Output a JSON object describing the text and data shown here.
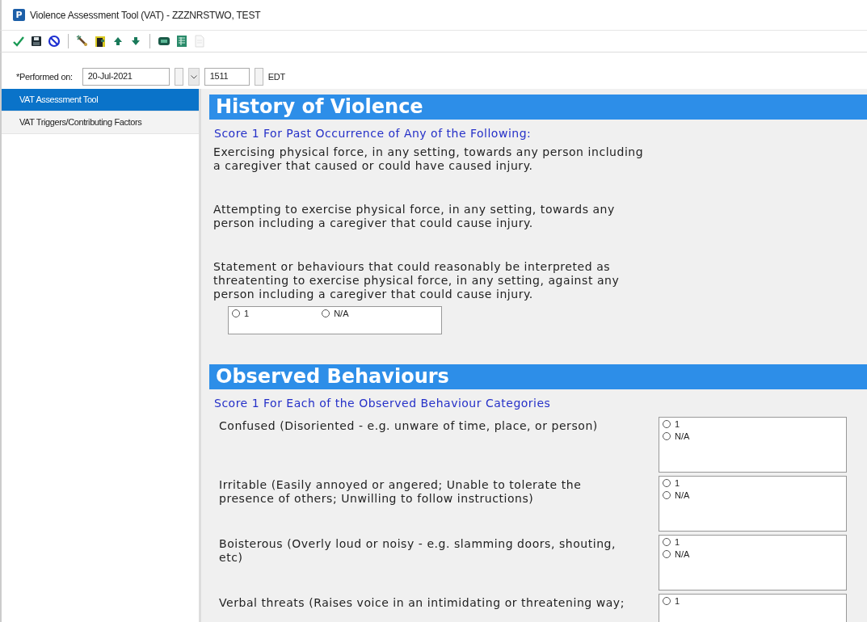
{
  "window": {
    "title": "Violence Assessment Tool (VAT) - ZZZNRSTWO, TEST",
    "app_icon": "P"
  },
  "toolbar": [
    {
      "kind": "check",
      "disabled": false
    },
    {
      "kind": "save",
      "disabled": false
    },
    {
      "kind": "cancel",
      "disabled": false
    },
    {
      "kind": "separator"
    },
    {
      "kind": "wand",
      "disabled": false
    },
    {
      "kind": "folder",
      "disabled": false
    },
    {
      "kind": "up",
      "disabled": false
    },
    {
      "kind": "down",
      "disabled": false
    },
    {
      "kind": "separator"
    },
    {
      "kind": "monitor",
      "disabled": false
    },
    {
      "kind": "sheet",
      "disabled": false
    },
    {
      "kind": "document",
      "disabled": true
    }
  ],
  "performed_on": {
    "label": "*Performed on:",
    "date": "20-Jul-2021",
    "time": "1511",
    "timezone": "EDT"
  },
  "sidebar": {
    "items": [
      {
        "label": "VAT Assessment Tool",
        "selected": true
      },
      {
        "label": "VAT Triggers/Contributing Factors",
        "selected": false
      }
    ]
  },
  "sections": [
    {
      "title": "History of Violence",
      "subtitle": "Score 1 For Past Occurrence of Any of the Following:",
      "paragraphs": [
        "Exercising physical force, in any setting, towards any person including a caregiver that caused or could have caused injury.",
        "Attempting to exercise physical force, in any setting, towards any person including a caregiver that could cause injury.",
        "Statement or behaviours that could reasonably be interpreted as threatenting to exercise physical force, in any setting, against any person including a caregiver that could cause injury."
      ],
      "options": [
        {
          "label": "1",
          "selected": false
        },
        {
          "label": "N/A",
          "selected": false
        }
      ]
    },
    {
      "title": "Observed Behaviours",
      "subtitle": "Score 1 For Each of the Observed Behaviour Categories",
      "questions": [
        {
          "text": "Confused (Disoriented - e.g. unware of time, place, or person)",
          "options": [
            {
              "label": "1",
              "selected": false
            },
            {
              "label": "N/A",
              "selected": false
            }
          ]
        },
        {
          "text": "Irritable (Easily annoyed or angered; Unable to tolerate the presence of others; Unwilling to follow instructions)",
          "options": [
            {
              "label": "1",
              "selected": false
            },
            {
              "label": "N/A",
              "selected": false
            }
          ]
        },
        {
          "text": "Boisterous (Overly loud or noisy - e.g. slamming doors, shouting, etc)",
          "options": [
            {
              "label": "1",
              "selected": false
            },
            {
              "label": "N/A",
              "selected": false
            }
          ]
        },
        {
          "text": "Verbal threats (Raises voice in an intimidating or threatening way;",
          "options": [
            {
              "label": "1",
              "selected": false
            }
          ]
        }
      ]
    }
  ]
}
